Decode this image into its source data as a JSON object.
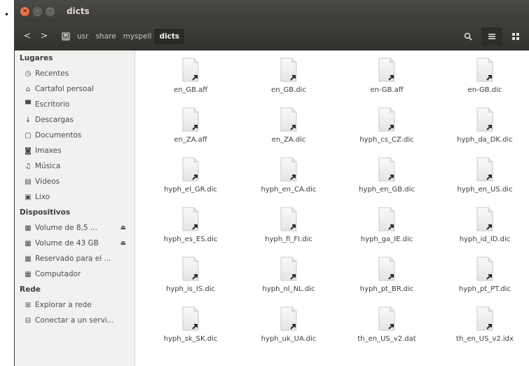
{
  "window": {
    "title": "dicts",
    "bullet": "•"
  },
  "titlebar_buttons": {
    "close": "×",
    "minimize": "–",
    "maximize": "□"
  },
  "nav": {
    "back": "<",
    "forward": ">"
  },
  "path": [
    "usr",
    "share",
    "myspell",
    "dicts"
  ],
  "toolbar_icons": [
    "search-icon",
    "list-view-icon",
    "grid-view-icon"
  ],
  "sidebar": {
    "places_header": "Lugares",
    "places": [
      {
        "label": "Recentes",
        "icon": "clock-icon"
      },
      {
        "label": "Cartafol persoal",
        "icon": "home-icon"
      },
      {
        "label": "Escritorio",
        "icon": "desktop-icon"
      },
      {
        "label": "Descargas",
        "icon": "download-icon"
      },
      {
        "label": "Documentos",
        "icon": "document-icon"
      },
      {
        "label": "Imaxes",
        "icon": "camera-icon"
      },
      {
        "label": "Música",
        "icon": "music-icon"
      },
      {
        "label": "Vídeos",
        "icon": "video-icon"
      },
      {
        "label": "Lixo",
        "icon": "trash-icon"
      }
    ],
    "devices_header": "Dispositivos",
    "devices": [
      {
        "label": "Volume de 8,5 ...",
        "icon": "drive-icon",
        "eject": true
      },
      {
        "label": "Volume de 43 GB",
        "icon": "drive-icon",
        "eject": true
      },
      {
        "label": "Reservado para el ...",
        "icon": "drive-icon",
        "eject": false
      },
      {
        "label": "Computador",
        "icon": "drive-icon",
        "eject": false
      }
    ],
    "network_header": "Rede",
    "network": [
      {
        "label": "Explorar a rede",
        "icon": "network-icon"
      },
      {
        "label": "Conectar a un servi...",
        "icon": "server-icon"
      }
    ]
  },
  "files": [
    "en_GB.aff",
    "en_GB.dic",
    "en-GB.aff",
    "en-GB.dic",
    "en_ZA.aff",
    "en_ZA.dic",
    "hyph_cs_CZ.dic",
    "hyph_da_DK.dic",
    "hyph_el_GR.dic",
    "hyph_en_CA.dic",
    "hyph_en_GB.dic",
    "hyph_en_US.dic",
    "hyph_es_ES.dic",
    "hyph_fi_FI.dic",
    "hyph_ga_IE.dic",
    "hyph_id_ID.dic",
    "hyph_is_IS.dic",
    "hyph_nl_NL.dic",
    "hyph_pt_BR.dic",
    "hyph_pt_PT.dic",
    "hyph_sk_SK.dic",
    "hyph_uk_UA.dic",
    "th_en_US_v2.dat",
    "th_en_US_v2.idx"
  ]
}
